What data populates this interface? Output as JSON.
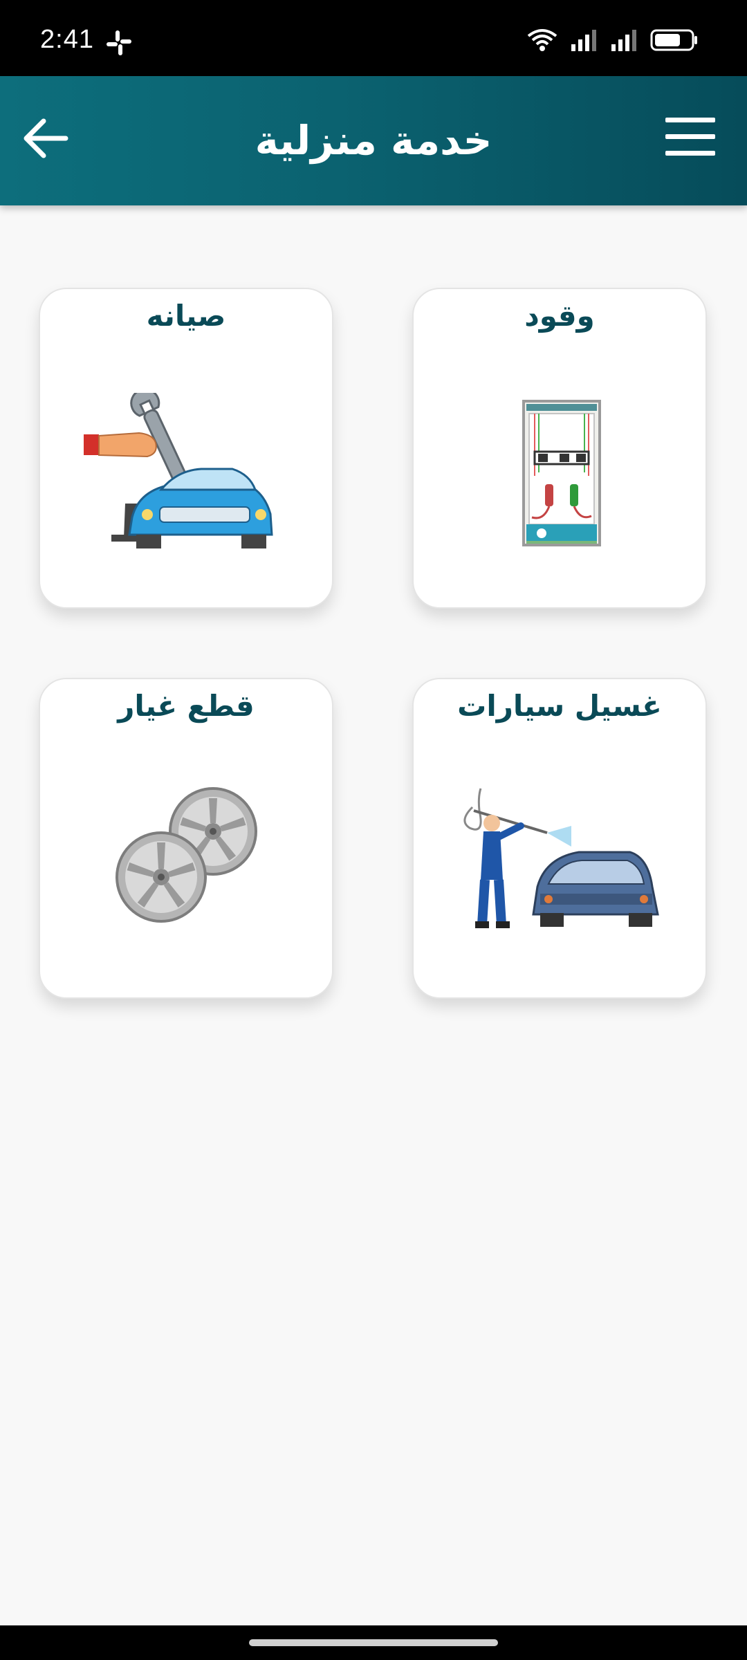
{
  "status_bar": {
    "time": "2:41",
    "icons": [
      "slack-icon",
      "wifi-icon",
      "signal-icon",
      "signal-icon",
      "battery-icon"
    ]
  },
  "header": {
    "title": "خدمة منزلية",
    "back_icon": "arrow-left-icon",
    "menu_icon": "hamburger-menu-icon",
    "colors": {
      "start": "#0d6e7c",
      "end": "#064c5a",
      "title": "#ffffff"
    }
  },
  "services": [
    {
      "id": "fuel",
      "label": "وقود",
      "icon": "fuel-pump-icon"
    },
    {
      "id": "maintenance",
      "label": "صيانه",
      "icon": "car-maintenance-icon"
    },
    {
      "id": "car-wash",
      "label": "غسيل سيارات",
      "icon": "car-wash-icon"
    },
    {
      "id": "spare-parts",
      "label": "قطع غيار",
      "icon": "wheel-rims-icon"
    }
  ],
  "colors": {
    "card_title": "#0a4a57",
    "background": "#f8f8f8"
  }
}
